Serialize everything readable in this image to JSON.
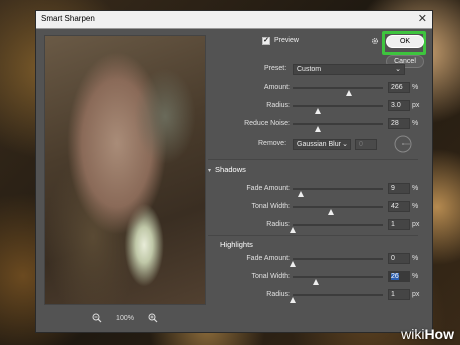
{
  "window": {
    "title": "Smart Sharpen",
    "close": "✕"
  },
  "preview": {
    "label": "Preview",
    "checked": true
  },
  "buttons": {
    "ok": "OK",
    "cancel": "Cancel"
  },
  "zoom": {
    "level": "100%"
  },
  "preset": {
    "label": "Preset:",
    "value": "Custom"
  },
  "main": [
    {
      "label": "Amount:",
      "value": "266",
      "unit": "%",
      "fraction": 0.62
    },
    {
      "label": "Radius:",
      "value": "3.0",
      "unit": "px",
      "fraction": 0.28
    },
    {
      "label": "Reduce Noise:",
      "value": "28",
      "unit": "%",
      "fraction": 0.28
    }
  ],
  "remove": {
    "label": "Remove:",
    "value": "Gaussian Blur",
    "angle": "0"
  },
  "shadows": {
    "title": "Shadows",
    "rows": [
      {
        "label": "Fade Amount:",
        "value": "9",
        "unit": "%",
        "fraction": 0.09
      },
      {
        "label": "Tonal Width:",
        "value": "42",
        "unit": "%",
        "fraction": 0.42
      },
      {
        "label": "Radius:",
        "value": "1",
        "unit": "px",
        "fraction": 0.0
      }
    ]
  },
  "highlights": {
    "title": "Highlights",
    "rows": [
      {
        "label": "Fade Amount:",
        "value": "0",
        "unit": "%",
        "fraction": 0.0
      },
      {
        "label": "Tonal Width:",
        "value": "26",
        "unit": "%",
        "fraction": 0.26,
        "selected": true
      },
      {
        "label": "Radius:",
        "value": "1",
        "unit": "px",
        "fraction": 0.0
      }
    ]
  },
  "watermark": {
    "wiki": "wiki",
    "how": "How"
  },
  "colors": {
    "highlight": "#3ec43e",
    "selection": "#2c5fb0"
  }
}
